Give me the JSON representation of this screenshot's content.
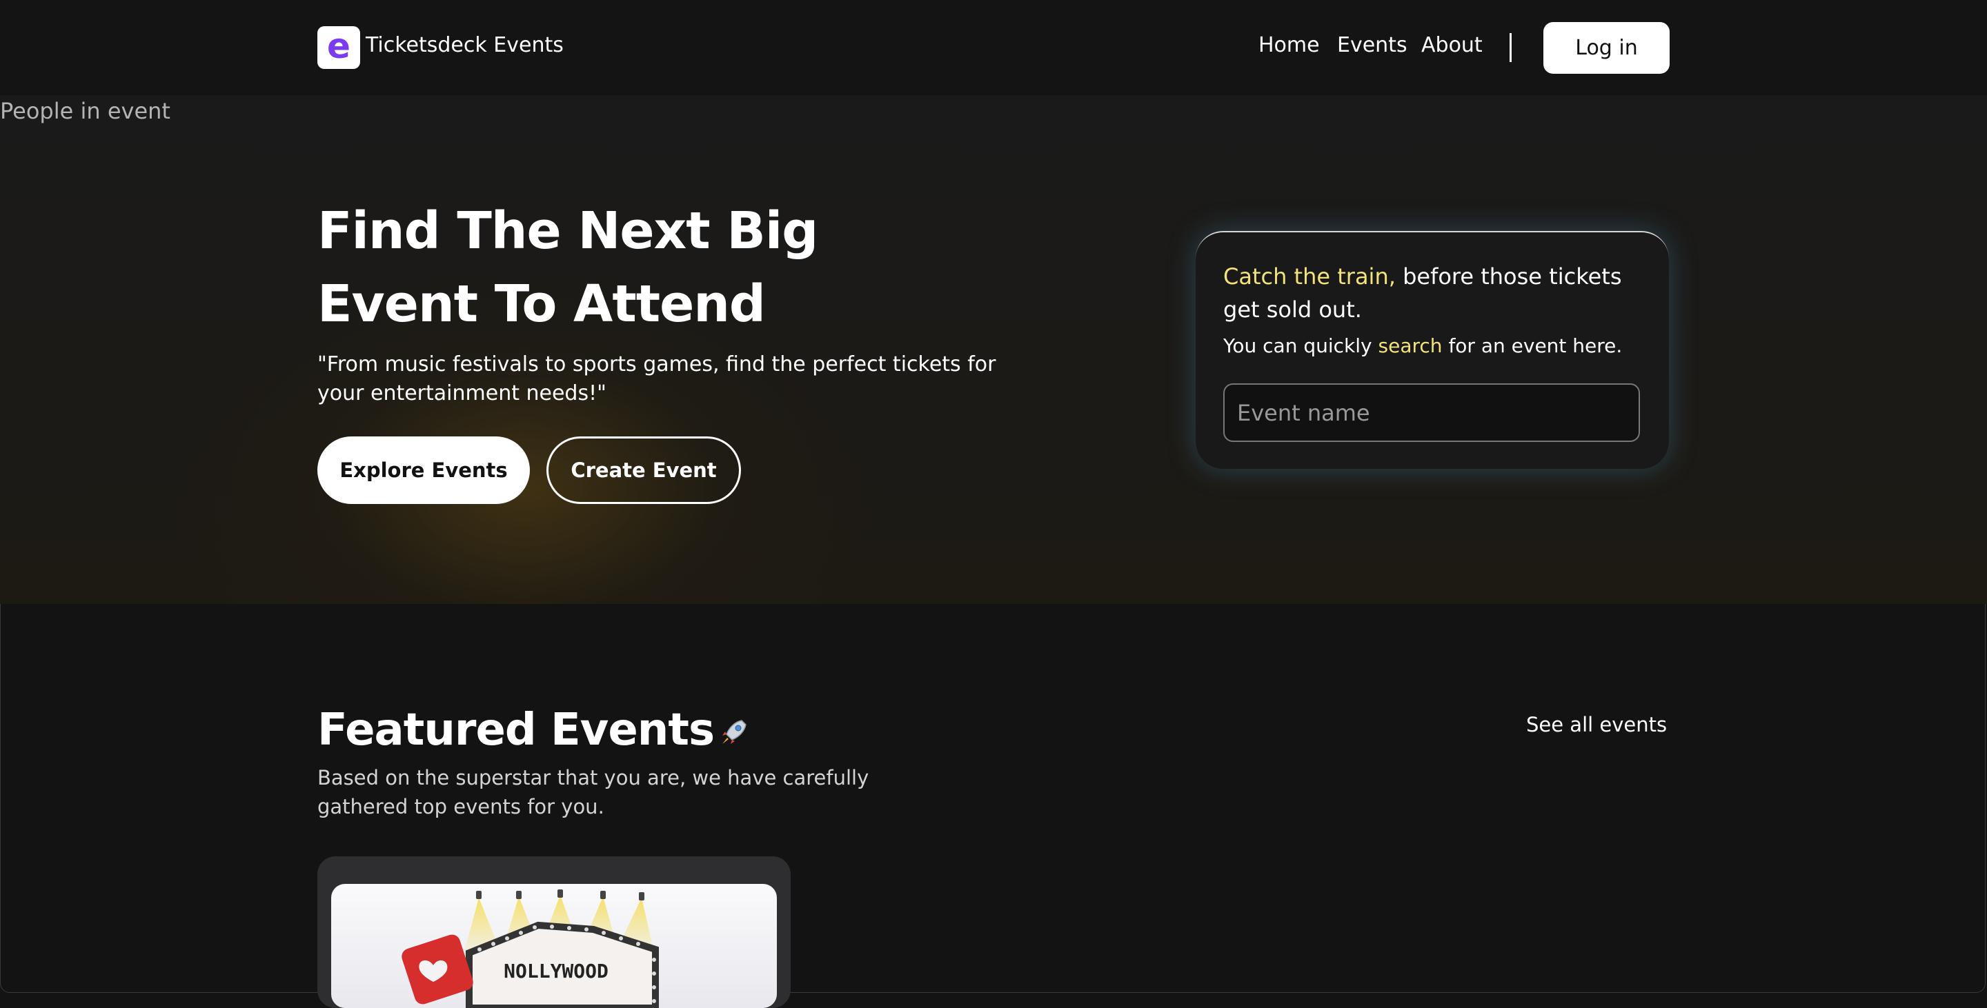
{
  "header": {
    "logo_letter": "e",
    "brand": "Ticketsdeck Events",
    "nav": [
      "Home",
      "Events",
      "About"
    ],
    "login": "Log in"
  },
  "overlay_label": "People in event",
  "hero": {
    "title_line1": "Find The Next Big",
    "title_line2": "Event To Attend",
    "subtitle": "\"From music festivals to sports games, find the perfect tickets for your entertainment needs!\"",
    "explore_button": "Explore Events",
    "create_button": "Create Event"
  },
  "search_card": {
    "highlight": "Catch the train,",
    "heading_rest": " before those tickets get sold out.",
    "line_before": "You can quickly ",
    "line_link": "search",
    "line_after": " for an event here.",
    "input_placeholder": "Event name"
  },
  "featured": {
    "title": "Featured Events",
    "see_all": "See all events",
    "subtitle": "Based on the superstar that you are, we have carefully gathered top events for you.",
    "card_image_text": "NOLLYWOOD"
  },
  "icons": {
    "rocket": "rocket-icon",
    "heart": "heart-icon"
  },
  "colors": {
    "accent_yellow": "#f3e37a",
    "logo_purple": "#7b3cf0",
    "background": "#131313"
  }
}
